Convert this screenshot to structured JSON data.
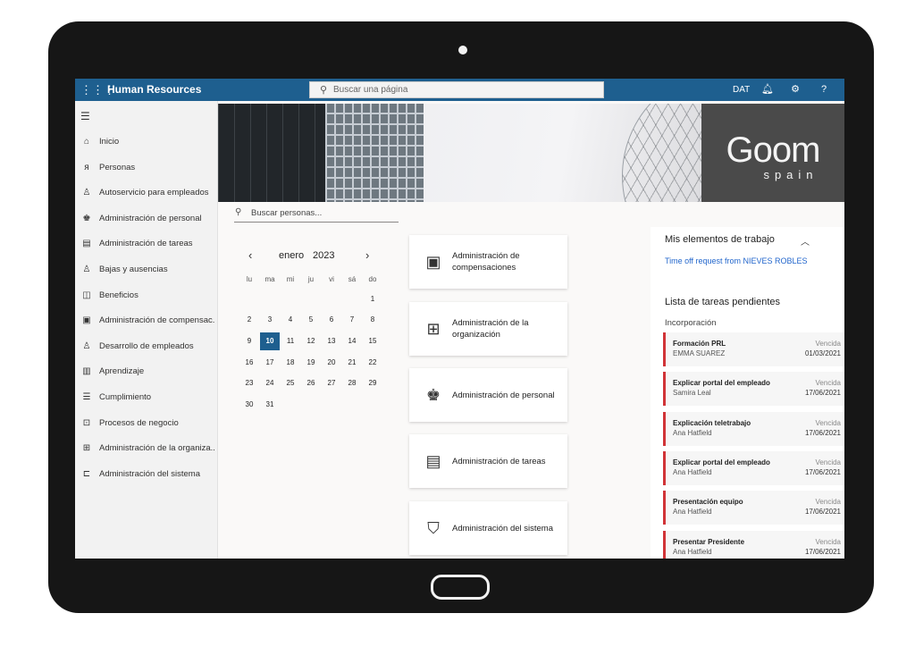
{
  "header": {
    "app_title": "Human Resources",
    "search_placeholder": "Buscar una página",
    "company_code": "DAT"
  },
  "nav": {
    "items": [
      {
        "label": "Inicio",
        "icon": "home-icon"
      },
      {
        "label": "Personas",
        "icon": "people-icon"
      },
      {
        "label": "Autoservicio para empleados",
        "icon": "self-service-icon"
      },
      {
        "label": "Administración de personal",
        "icon": "personnel-icon"
      },
      {
        "label": "Administración de tareas",
        "icon": "clipboard-icon"
      },
      {
        "label": "Bajas y ausencias",
        "icon": "leave-icon"
      },
      {
        "label": "Beneficios",
        "icon": "benefits-icon"
      },
      {
        "label": "Administración de compensac...",
        "icon": "compensation-icon"
      },
      {
        "label": "Desarrollo de empleados",
        "icon": "development-icon"
      },
      {
        "label": "Aprendizaje",
        "icon": "learning-icon"
      },
      {
        "label": "Cumplimiento",
        "icon": "compliance-icon"
      },
      {
        "label": "Procesos de negocio",
        "icon": "process-icon"
      },
      {
        "label": "Administración de la organiza...",
        "icon": "organization-icon"
      },
      {
        "label": "Administración del sistema",
        "icon": "system-icon"
      }
    ]
  },
  "banner": {
    "logo_main": "Goom",
    "logo_sub": "spain"
  },
  "people_search": {
    "placeholder": "Buscar personas..."
  },
  "calendar": {
    "month": "enero",
    "year": "2023",
    "weekdays": [
      "lu",
      "ma",
      "mi",
      "ju",
      "vi",
      "sá",
      "do"
    ],
    "weeks": [
      [
        "",
        "",
        "",
        "",
        "",
        "",
        "1"
      ],
      [
        "2",
        "3",
        "4",
        "5",
        "6",
        "7",
        "8"
      ],
      [
        "9",
        "10",
        "11",
        "12",
        "13",
        "14",
        "15"
      ],
      [
        "16",
        "17",
        "18",
        "19",
        "20",
        "21",
        "22"
      ],
      [
        "23",
        "24",
        "25",
        "26",
        "27",
        "28",
        "29"
      ],
      [
        "30",
        "31",
        "",
        "",
        "",
        "",
        ""
      ]
    ],
    "selected_day": "10"
  },
  "tiles": [
    {
      "label": "Administración de compensaciones",
      "icon": "compensation-icon"
    },
    {
      "label": "Administración de la organización",
      "icon": "organization-icon"
    },
    {
      "label": "Administración de personal",
      "icon": "personnel-icon"
    },
    {
      "label": "Administración de tareas",
      "icon": "clipboard-icon"
    },
    {
      "label": "Administración del sistema",
      "icon": "system-shield-icon"
    }
  ],
  "work_items": {
    "title": "Mis elementos de trabajo",
    "link": "Time off request from NIEVES ROBLES"
  },
  "tasks": {
    "title": "Lista de tareas pendientes",
    "section": "Incorporación",
    "items": [
      {
        "title": "Formación PRL",
        "person": "EMMA SUAREZ",
        "status": "Vencida",
        "date": "01/03/2021"
      },
      {
        "title": "Explicar portal del empleado",
        "person": "Samira Leal",
        "status": "Vencida",
        "date": "17/06/2021"
      },
      {
        "title": "Explicación teletrabajo",
        "person": "Ana Hatfield",
        "status": "Vencida",
        "date": "17/06/2021"
      },
      {
        "title": "Explicar portal del empleado",
        "person": "Ana Hatfield",
        "status": "Vencida",
        "date": "17/06/2021"
      },
      {
        "title": "Presentación equipo",
        "person": "Ana Hatfield",
        "status": "Vencida",
        "date": "17/06/2021"
      },
      {
        "title": "Presentar Presidente",
        "person": "Ana Hatfield",
        "status": "Vencida",
        "date": "17/06/2021"
      }
    ]
  },
  "colors": {
    "topbar": "#1e5f8f",
    "accent": "#1e5f8f",
    "task_flag": "#d13438",
    "link": "#2266cc"
  }
}
